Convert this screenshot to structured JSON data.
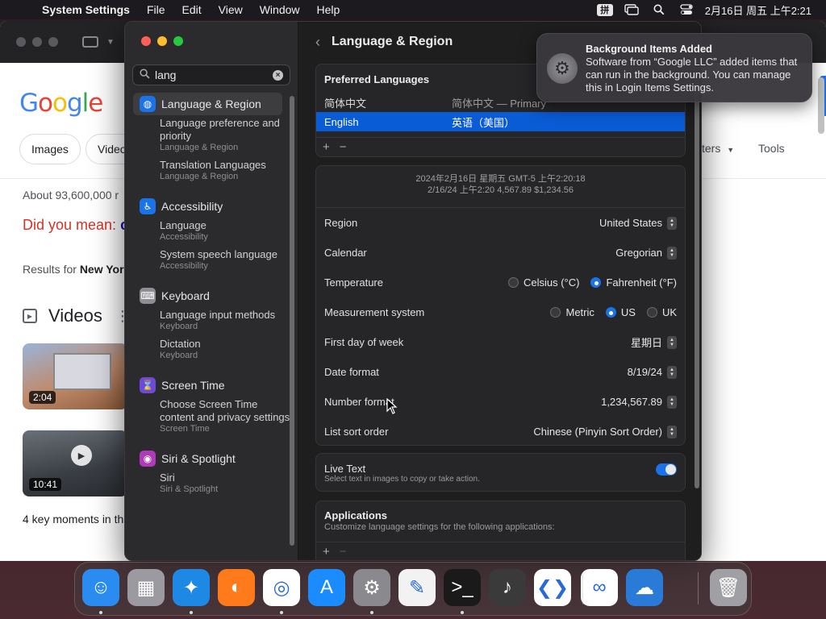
{
  "menubar": {
    "app": "System Settings",
    "items": [
      "File",
      "Edit",
      "View",
      "Window",
      "Help"
    ],
    "ime": "拼",
    "clock": "2月16日 周五 上午2:21"
  },
  "browser": {
    "chips": [
      "Images",
      "Videos"
    ],
    "about": "About 93,600,000 r",
    "did_you_mean": "Did you mean:",
    "results_for_prefix": "Results for",
    "results_for_bold": "New Yor",
    "videos_heading": "Videos",
    "video_durations": [
      "2:04",
      "10:41"
    ],
    "key_moments": "4 key moments in th",
    "filters": "ters",
    "tools": "Tools"
  },
  "settings": {
    "search": {
      "value": "lang",
      "placeholder": "Search"
    },
    "sidebar": [
      {
        "label": "Language & Region",
        "icon": "globe-icon",
        "color": "#1a73e8",
        "selected": true,
        "subs": [
          {
            "title": "Language preference and priority",
            "sub": "Language & Region"
          },
          {
            "title": "Translation Languages",
            "sub": "Language & Region"
          }
        ]
      },
      {
        "label": "Accessibility",
        "icon": "accessibility-icon",
        "color": "#1a73e8",
        "subs": [
          {
            "title": "Language",
            "sub": "Accessibility"
          },
          {
            "title": "System speech language",
            "sub": "Accessibility"
          }
        ]
      },
      {
        "label": "Keyboard",
        "icon": "keyboard-icon",
        "color": "#8e8e93",
        "subs": [
          {
            "title": "Language input methods",
            "sub": "Keyboard"
          },
          {
            "title": "Dictation",
            "sub": "Keyboard"
          }
        ]
      },
      {
        "label": "Screen Time",
        "icon": "hourglass-icon",
        "color": "#6e4ad8",
        "subs": [
          {
            "title": "Choose Screen Time content and privacy settings",
            "sub": "Screen Time"
          }
        ]
      },
      {
        "label": "Siri & Spotlight",
        "icon": "siri-icon",
        "color": "#b03ab8",
        "subs": [
          {
            "title": "Siri",
            "sub": "Siri & Spotlight"
          }
        ]
      }
    ],
    "title": "Language & Region",
    "preferred": {
      "heading": "Preferred Languages",
      "rows": [
        {
          "name": "简体中文",
          "desc": "简体中文 — Primary",
          "selected": false
        },
        {
          "name": "English",
          "desc": "英语（美国）",
          "selected": true
        }
      ],
      "plus": "+",
      "minus": "−"
    },
    "preview_line1": "2024年2月16日 星期五 GMT-5 上午2:20:18",
    "preview_line2": "2/16/24 上午2:20     4,567.89     $1,234.56",
    "rows": {
      "region": {
        "label": "Region",
        "value": "United States"
      },
      "calendar": {
        "label": "Calendar",
        "value": "Gregorian"
      },
      "temperature": {
        "label": "Temperature",
        "options": [
          "Celsius (°C)",
          "Fahrenheit (°F)"
        ],
        "selected": "Fahrenheit (°F)"
      },
      "measurement": {
        "label": "Measurement system",
        "options": [
          "Metric",
          "US",
          "UK"
        ],
        "selected": "US"
      },
      "first_day": {
        "label": "First day of week",
        "value": "星期日"
      },
      "date_format": {
        "label": "Date format",
        "value": "8/19/24"
      },
      "number_format": {
        "label": "Number format",
        "value": "1,234,567.89"
      },
      "sort_order": {
        "label": "List sort order",
        "value": "Chinese (Pinyin Sort Order)"
      }
    },
    "live_text": {
      "label": "Live Text",
      "desc": "Select text in images to copy or take action.",
      "on": true
    },
    "applications": {
      "heading": "Applications",
      "desc": "Customize language settings for the following applications:"
    }
  },
  "notification": {
    "title": "Background Items Added",
    "body": "Software from “Google LLC” added items that can run in the background. You can manage this in Login Items Settings."
  },
  "dock": [
    {
      "name": "Finder",
      "icon": "finder-icon",
      "color": "#2a8cf0",
      "running": true
    },
    {
      "name": "Launchpad",
      "icon": "launchpad-icon",
      "color": "#9a9aa0",
      "running": false
    },
    {
      "name": "Safari",
      "icon": "safari-icon",
      "color": "#1e88e5",
      "running": true
    },
    {
      "name": "Firefox",
      "icon": "firefox-icon",
      "color": "#ff7a1a",
      "running": false
    },
    {
      "name": "Chrome",
      "icon": "chrome-icon",
      "color": "#ffffff",
      "running": true
    },
    {
      "name": "App Store",
      "icon": "app-store-icon",
      "color": "#1a8cff",
      "running": false
    },
    {
      "name": "System Settings",
      "icon": "system-settings-icon",
      "color": "#8a8a8e",
      "running": true
    },
    {
      "name": "TextEdit",
      "icon": "textedit-icon",
      "color": "#f2f2f2",
      "running": false
    },
    {
      "name": "Terminal",
      "icon": "terminal-icon",
      "color": "#1a1a1a",
      "running": true
    },
    {
      "name": "GarageBand",
      "icon": "garageband-icon",
      "color": "#3a3a3a",
      "running": false
    },
    {
      "name": "VS Code",
      "icon": "vscode-icon",
      "color": "#ffffff",
      "running": false
    },
    {
      "name": "Visual Studio",
      "icon": "visual-studio-icon",
      "color": "#ffffff",
      "running": false
    },
    {
      "name": "Weather",
      "icon": "weather-icon",
      "color": "#2a7ad8",
      "running": false
    },
    {
      "name": "Trash",
      "icon": "trash-icon",
      "color": "#a0a0a4",
      "running": false
    }
  ]
}
